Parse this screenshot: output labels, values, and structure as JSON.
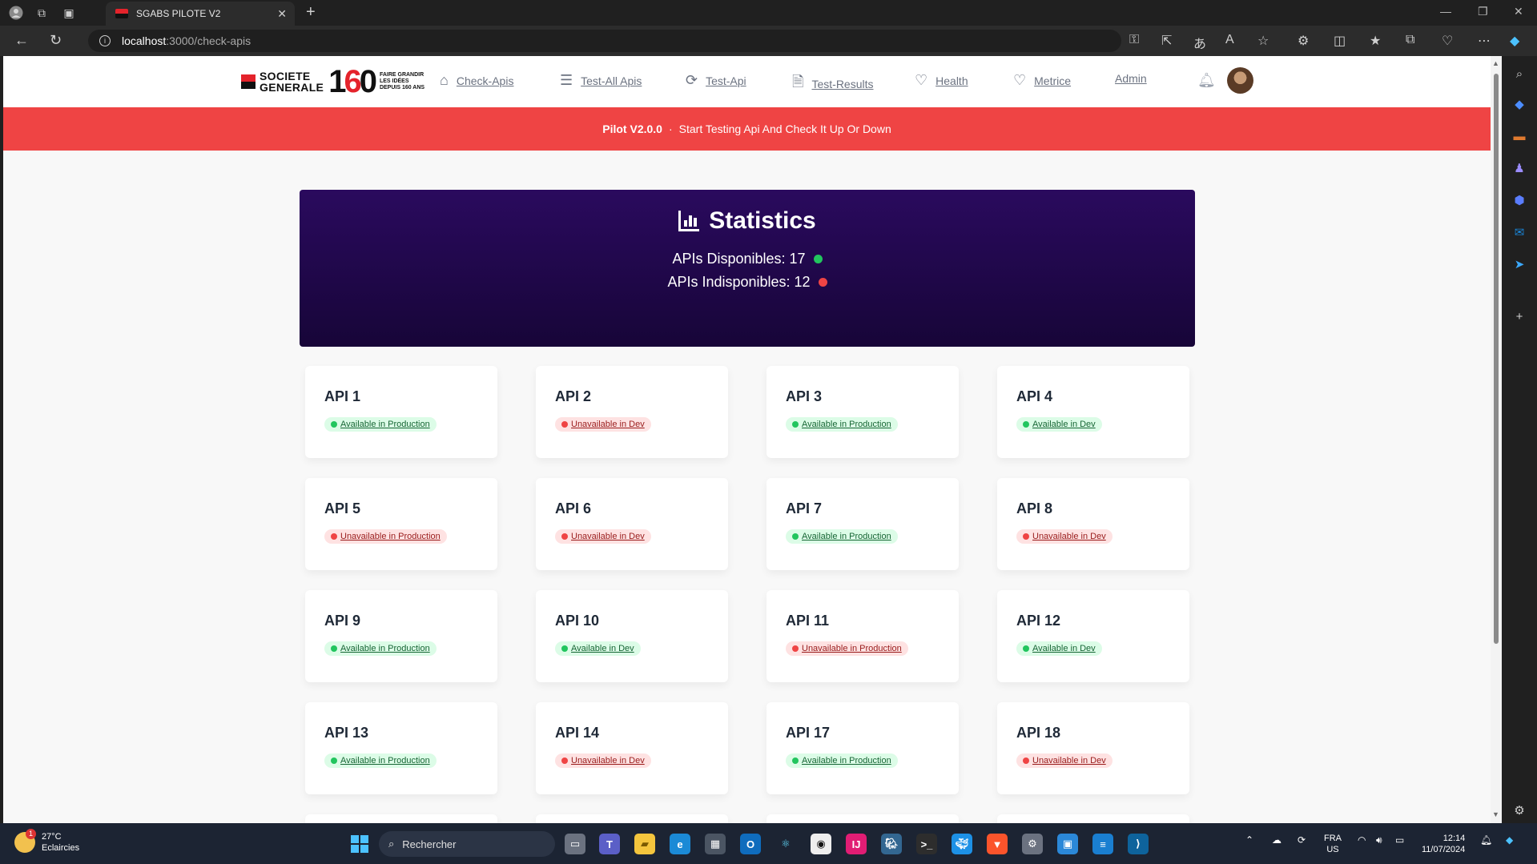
{
  "browser": {
    "tab_title": "SGABS PILOTE V2",
    "url_host": "localhost",
    "url_path": ":3000/check-apis"
  },
  "app": {
    "logo": {
      "brand_line1": "SOCIETE",
      "brand_line2": "GENERALE",
      "number_1": "1",
      "number_6": "6",
      "number_0": "0",
      "tagline_1": "FAIRE GRANDIR",
      "tagline_2": "LES IDÉES",
      "tagline_3": "DEPUIS 160 ANS"
    },
    "nav": [
      {
        "label": "Check-Apis",
        "icon": "home-icon"
      },
      {
        "label": "Test-All Apis",
        "icon": "list-icon"
      },
      {
        "label": "Test-Api",
        "icon": "refresh-icon"
      },
      {
        "label": "Test-Results",
        "icon": "document-icon"
      },
      {
        "label": "Health",
        "icon": "heart-icon"
      },
      {
        "label": "Metrice",
        "icon": "heart-icon"
      },
      {
        "label": "Admin",
        "icon": ""
      }
    ],
    "banner": {
      "version": "Pilot V2.0.0",
      "separator": "·",
      "message": "Start Testing Api And Check It Up Or Down"
    },
    "statistics": {
      "title": "Statistics",
      "available_label": "APIs Disponibles: 17",
      "unavailable_label": "APIs Indisponibles: 12",
      "available_color": "#22c55e",
      "unavailable_color": "#ef4444"
    },
    "apis": [
      {
        "name": "API 1",
        "status": "Available in Production",
        "ok": true
      },
      {
        "name": "API 2",
        "status": "Unavailable in Dev",
        "ok": false
      },
      {
        "name": "API 3",
        "status": "Available in Production",
        "ok": true
      },
      {
        "name": "API 4",
        "status": "Available in Dev",
        "ok": true
      },
      {
        "name": "API 5",
        "status": "Unavailable in Production",
        "ok": false
      },
      {
        "name": "API 6",
        "status": "Unavailable in Dev",
        "ok": false
      },
      {
        "name": "API 7",
        "status": "Available in Production",
        "ok": true
      },
      {
        "name": "API 8",
        "status": "Unavailable in Dev",
        "ok": false
      },
      {
        "name": "API 9",
        "status": "Available in Production",
        "ok": true
      },
      {
        "name": "API 10",
        "status": "Available in Dev",
        "ok": true
      },
      {
        "name": "API 11",
        "status": "Unavailable in Production",
        "ok": false
      },
      {
        "name": "API 12",
        "status": "Available in Dev",
        "ok": true
      },
      {
        "name": "API 13",
        "status": "Available in Production",
        "ok": true
      },
      {
        "name": "API 14",
        "status": "Unavailable in Dev",
        "ok": false
      },
      {
        "name": "API 17",
        "status": "Available in Production",
        "ok": true
      },
      {
        "name": "API 18",
        "status": "Unavailable in Dev",
        "ok": false
      }
    ]
  },
  "taskbar": {
    "weather_temp": "27°C",
    "weather_desc": "Eclaircies",
    "weather_badge": "1",
    "search_placeholder": "Rechercher",
    "lang_1": "FRA",
    "lang_2": "US",
    "time": "12:14",
    "date": "11/07/2024"
  }
}
